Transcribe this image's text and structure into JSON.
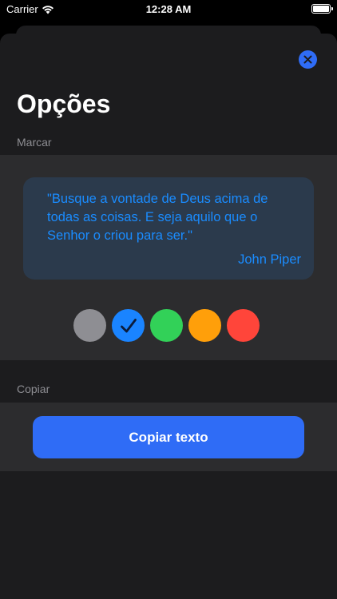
{
  "status_bar": {
    "carrier": "Carrier",
    "time": "12:28 AM"
  },
  "header": {
    "title": "Opções",
    "close_icon": "close-icon"
  },
  "highlight_section": {
    "label": "Marcar",
    "quote": {
      "text": "\"Busque a vontade de Deus acima de todas as coisas. E seja aquilo que o Senhor o criou para ser.\"",
      "author": "John Piper",
      "text_color": "#1a8cff",
      "card_color": "#2b3a4c"
    },
    "colors": [
      {
        "name": "gray",
        "hex": "#8e8e93",
        "selected": false
      },
      {
        "name": "blue",
        "hex": "#1a84ff",
        "selected": true
      },
      {
        "name": "green",
        "hex": "#32d158",
        "selected": false
      },
      {
        "name": "orange",
        "hex": "#ff9f0a",
        "selected": false
      },
      {
        "name": "red",
        "hex": "#ff453a",
        "selected": false
      }
    ]
  },
  "copy_section": {
    "label": "Copiar",
    "button_label": "Copiar texto",
    "button_color": "#2f6cf6"
  }
}
